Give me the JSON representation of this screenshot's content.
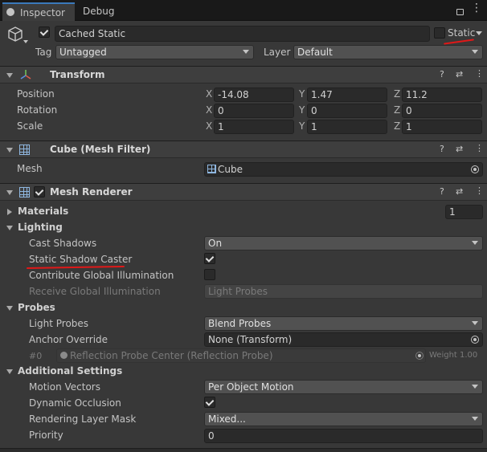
{
  "tabs": {
    "inspector": "Inspector",
    "debug": "Debug"
  },
  "object": {
    "enabled": true,
    "name": "Cached Static",
    "static_checked": false,
    "static_label": "Static",
    "tag_label": "Tag",
    "tag_value": "Untagged",
    "layer_label": "Layer",
    "layer_value": "Default"
  },
  "transform": {
    "title": "Transform",
    "position_label": "Position",
    "rotation_label": "Rotation",
    "scale_label": "Scale",
    "axis_x": "X",
    "axis_y": "Y",
    "axis_z": "Z",
    "position": {
      "x": "-14.08",
      "y": "1.47",
      "z": "11.2"
    },
    "rotation": {
      "x": "0",
      "y": "0",
      "z": "0"
    },
    "scale": {
      "x": "1",
      "y": "1",
      "z": "1"
    }
  },
  "mesh_filter": {
    "title": "Cube (Mesh Filter)",
    "mesh_label": "Mesh",
    "mesh_value": "Cube"
  },
  "mesh_renderer": {
    "title": "Mesh Renderer",
    "enabled": true,
    "materials_label": "Materials",
    "materials_count": "1",
    "lighting_label": "Lighting",
    "cast_shadows_label": "Cast Shadows",
    "cast_shadows_value": "On",
    "static_shadow_caster_label": "Static Shadow Caster",
    "static_shadow_caster_checked": true,
    "contribute_gi_label": "Contribute Global Illumination",
    "contribute_gi_checked": false,
    "receive_gi_label": "Receive Global Illumination",
    "receive_gi_value": "Light Probes",
    "probes_label": "Probes",
    "light_probes_label": "Light Probes",
    "light_probes_value": "Blend Probes",
    "anchor_override_label": "Anchor Override",
    "anchor_override_value": "None (Transform)",
    "probe_index": "#0",
    "reflection_probe_value": "Reflection Probe Center (Reflection Probe)",
    "weight_text": "Weight 1.00",
    "additional_label": "Additional Settings",
    "motion_vectors_label": "Motion Vectors",
    "motion_vectors_value": "Per Object Motion",
    "dynamic_occlusion_label": "Dynamic Occlusion",
    "dynamic_occlusion_checked": true,
    "rendering_layer_mask_label": "Rendering Layer Mask",
    "rendering_layer_mask_value": "Mixed...",
    "priority_label": "Priority",
    "priority_value": "0"
  },
  "header_icons": {
    "help": "?",
    "presets": "⇄",
    "more": "⋮"
  },
  "colors": {
    "background": "#383838",
    "accent_tab": "#3a79bb",
    "annotation_red": "#e01818"
  }
}
